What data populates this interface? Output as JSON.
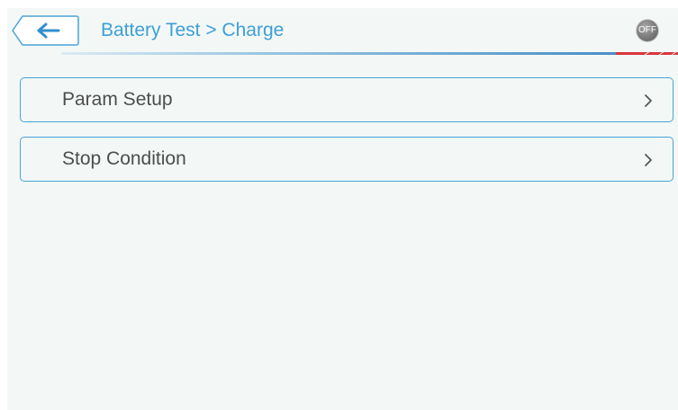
{
  "header": {
    "back_icon": "arrow-left-icon",
    "breadcrumb": "Battery Test > Charge",
    "power_label": "OFF"
  },
  "colors": {
    "accent": "#3d9fd6",
    "border": "#4aa3d9",
    "background": "#f3f8f6",
    "text": "#4d4d4d",
    "power_off": "#7a7a7a",
    "header_rule_red": "#d9363e"
  },
  "menu": {
    "items": [
      {
        "label": "Param Setup",
        "icon": "chevron-right-icon"
      },
      {
        "label": "Stop Condition",
        "icon": "chevron-right-icon"
      }
    ]
  }
}
